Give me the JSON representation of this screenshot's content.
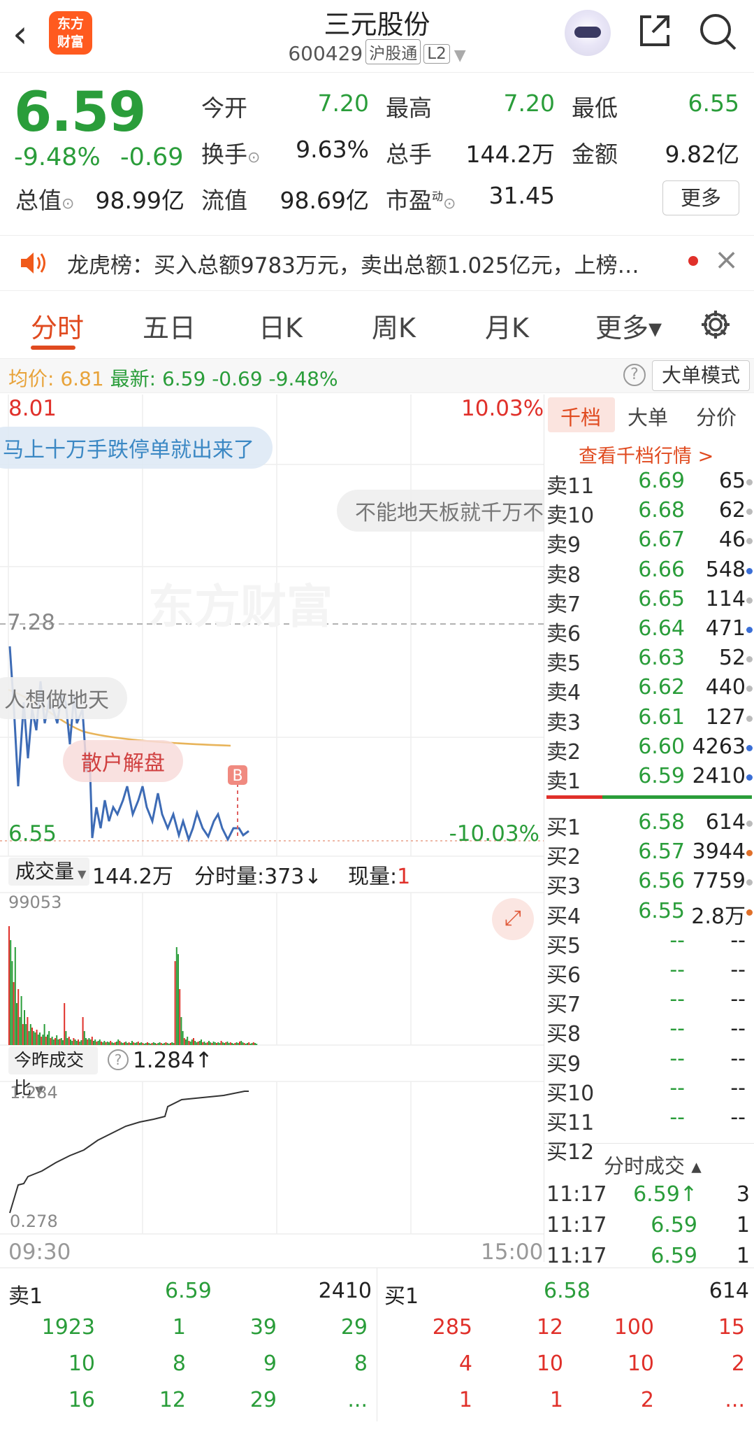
{
  "header": {
    "back": "‹",
    "logo": "东方财富",
    "title": "三元股份",
    "code": "600429",
    "tag1": "沪股通",
    "tag2": "L2"
  },
  "quote": {
    "price": "6.59",
    "pct": "-9.48%",
    "chg": "-0.69",
    "open_l": "今开",
    "open": "7.20",
    "high_l": "最高",
    "high": "7.20",
    "low_l": "最低",
    "low": "6.55",
    "turn_l": "换手",
    "turn": "9.63%",
    "vol_l": "总手",
    "vol": "144.2万",
    "amt_l": "金额",
    "amt": "9.82亿",
    "mcap_l": "总值",
    "mcap": "98.99亿",
    "fcap_l": "流值",
    "fcap": "98.69亿",
    "pe_l": "市盈",
    "pe_sup": "动",
    "pe": "31.45",
    "more": "更多"
  },
  "notice": {
    "text": "龙虎榜：买入总额9783万元，卖出总额1.025亿元，上榜…",
    "close": "×"
  },
  "tabs": [
    "分时",
    "五日",
    "日K",
    "周K",
    "月K",
    "更多▾"
  ],
  "info": {
    "avg_l": "均价:",
    "avg": "6.81",
    "last_l": "最新:",
    "last": "6.59",
    "chg": "-0.69",
    "pct": "-9.48%",
    "help": "?",
    "mode": "大单模式"
  },
  "chart": {
    "top_price": "8.01",
    "top_pct": "10.03%",
    "mid_price": "7.28",
    "low_price": "6.55",
    "low_pct": "-10.03%",
    "watermark": "东方财富",
    "b_marker": "B",
    "bubbles": [
      "马上十万手跌停单就出来了",
      "不能地天板就千万不",
      "人想做地天",
      "散户解盘"
    ],
    "vol_bar": {
      "label": "成交量",
      "total": "144.2万",
      "fs_l": "分时量:",
      "fs": "373↓",
      "cur_l": "现量:",
      "cur": "1",
      "max": "99053"
    },
    "ratio": {
      "label": "今昨成交比",
      "value": "1.284↑",
      "max": "1.284",
      "min": "0.278"
    },
    "time_start": "09:30",
    "time_end": "15:00"
  },
  "book_tabs": [
    "千档",
    "大单",
    "分价"
  ],
  "book_link": "查看千档行情 >",
  "sells": [
    [
      "卖11",
      "6.69",
      "65",
      "#bbb"
    ],
    [
      "卖10",
      "6.68",
      "62",
      "#bbb"
    ],
    [
      "卖9",
      "6.67",
      "46",
      "#bbb"
    ],
    [
      "卖8",
      "6.66",
      "548",
      "#3b6fd6"
    ],
    [
      "卖7",
      "6.65",
      "114",
      "#bbb"
    ],
    [
      "卖6",
      "6.64",
      "471",
      "#3b6fd6"
    ],
    [
      "卖5",
      "6.63",
      "52",
      "#bbb"
    ],
    [
      "卖4",
      "6.62",
      "440",
      "#bbb"
    ],
    [
      "卖3",
      "6.61",
      "127",
      "#bbb"
    ],
    [
      "卖2",
      "6.60",
      "4263",
      "#3b6fd6"
    ],
    [
      "卖1",
      "6.59",
      "2410",
      "#3b6fd6"
    ]
  ],
  "buys": [
    [
      "买1",
      "6.58",
      "614",
      "#bbb"
    ],
    [
      "买2",
      "6.57",
      "3944",
      "#e0702a"
    ],
    [
      "买3",
      "6.56",
      "7759",
      "#bbb"
    ],
    [
      "买4",
      "6.55",
      "2.8万",
      "#e0702a"
    ],
    [
      "买5",
      "--",
      "--",
      ""
    ],
    [
      "买6",
      "--",
      "--",
      ""
    ],
    [
      "买7",
      "--",
      "--",
      ""
    ],
    [
      "买8",
      "--",
      "--",
      ""
    ],
    [
      "买9",
      "--",
      "--",
      ""
    ],
    [
      "买10",
      "--",
      "--",
      ""
    ],
    [
      "买11",
      "--",
      "--",
      ""
    ],
    [
      "买12",
      "",
      ""
    ]
  ],
  "ticks": {
    "title": "分时成交 ▴",
    "rows": [
      [
        "11:17",
        "6.59↑",
        "3"
      ],
      [
        "11:17",
        "6.59",
        "1"
      ],
      [
        "11:17",
        "6.59",
        "1"
      ]
    ]
  },
  "bottom": {
    "sell_l": "卖1",
    "sell_p": "6.59",
    "sell_v": "2410",
    "buy_l": "买1",
    "buy_p": "6.58",
    "buy_v": "614",
    "sell_queue": [
      [
        "1923",
        "1",
        "39",
        "29"
      ],
      [
        "10",
        "8",
        "9",
        "8"
      ],
      [
        "16",
        "12",
        "29",
        "..."
      ]
    ],
    "buy_queue": [
      [
        "285",
        "12",
        "100",
        "15"
      ],
      [
        "4",
        "10",
        "10",
        "2"
      ],
      [
        "1",
        "1",
        "2",
        "..."
      ]
    ]
  }
}
